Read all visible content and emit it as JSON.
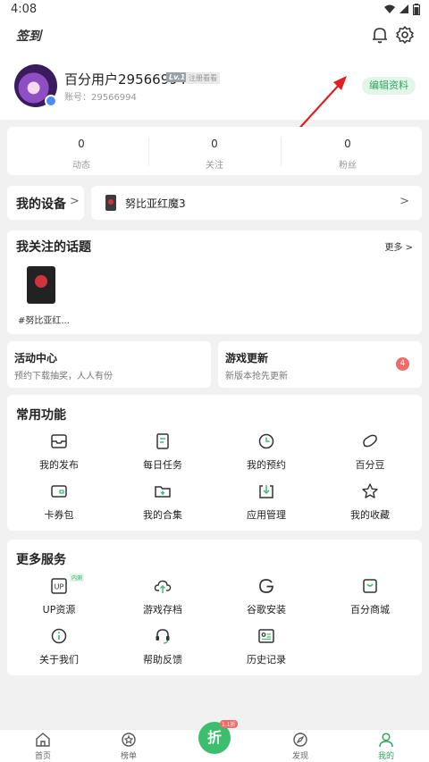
{
  "status_bar": {
    "time": "4:08"
  },
  "header": {
    "signin_label": "签到"
  },
  "profile": {
    "username": "百分用户29566994",
    "level": "Lv.1",
    "reg_tag": "注册看看",
    "account": "账号：29566994",
    "edit_label": "编辑资料"
  },
  "stats": [
    {
      "value": "0",
      "label": "动态"
    },
    {
      "value": "0",
      "label": "关注"
    },
    {
      "value": "0",
      "label": "粉丝"
    }
  ],
  "devices": {
    "title": "我的设备",
    "device_name": "努比亚红魔3"
  },
  "topics": {
    "title": "我关注的话题",
    "more": "更多 >",
    "items": [
      {
        "name": "#努比亚红..."
      }
    ]
  },
  "activities": [
    {
      "title": "活动中心",
      "subtitle": "预约下载抽奖，人人有份"
    },
    {
      "title": "游戏更新",
      "subtitle": "新版本抢先更新",
      "badge": "4"
    }
  ],
  "common_functions": {
    "title": "常用功能",
    "items": [
      {
        "label": "我的发布",
        "icon": "inbox-icon"
      },
      {
        "label": "每日任务",
        "icon": "task-list-icon"
      },
      {
        "label": "我的预约",
        "icon": "clock-icon"
      },
      {
        "label": "百分豆",
        "icon": "bean-icon"
      },
      {
        "label": "卡券包",
        "icon": "wallet-icon"
      },
      {
        "label": "我的合集",
        "icon": "folder-plus-icon"
      },
      {
        "label": "应用管理",
        "icon": "download-box-icon"
      },
      {
        "label": "我的收藏",
        "icon": "star-icon"
      }
    ]
  },
  "more_services": {
    "title": "更多服务",
    "items": [
      {
        "label": "UP资源",
        "icon": "up-icon",
        "tag": "内测"
      },
      {
        "label": "游戏存档",
        "icon": "cloud-upload-icon"
      },
      {
        "label": "谷歌安装",
        "icon": "google-icon"
      },
      {
        "label": "百分商城",
        "icon": "shop-bag-icon"
      },
      {
        "label": "关于我们",
        "icon": "info-icon"
      },
      {
        "label": "帮助反馈",
        "icon": "headset-icon"
      },
      {
        "label": "历史记录",
        "icon": "history-card-icon"
      }
    ]
  },
  "bottom_nav": {
    "items": [
      {
        "label": "首页",
        "icon": "home-icon"
      },
      {
        "label": "榜单",
        "icon": "ranking-icon"
      },
      {
        "label": "发现",
        "icon": "discover-icon"
      },
      {
        "label": "我的",
        "icon": "user-icon"
      }
    ],
    "fab_label": "折",
    "fab_badge": "1.1折"
  },
  "colors": {
    "accent": "#2fa862",
    "annotation_arrow": "#e02020",
    "badge": "#f06a6a"
  }
}
